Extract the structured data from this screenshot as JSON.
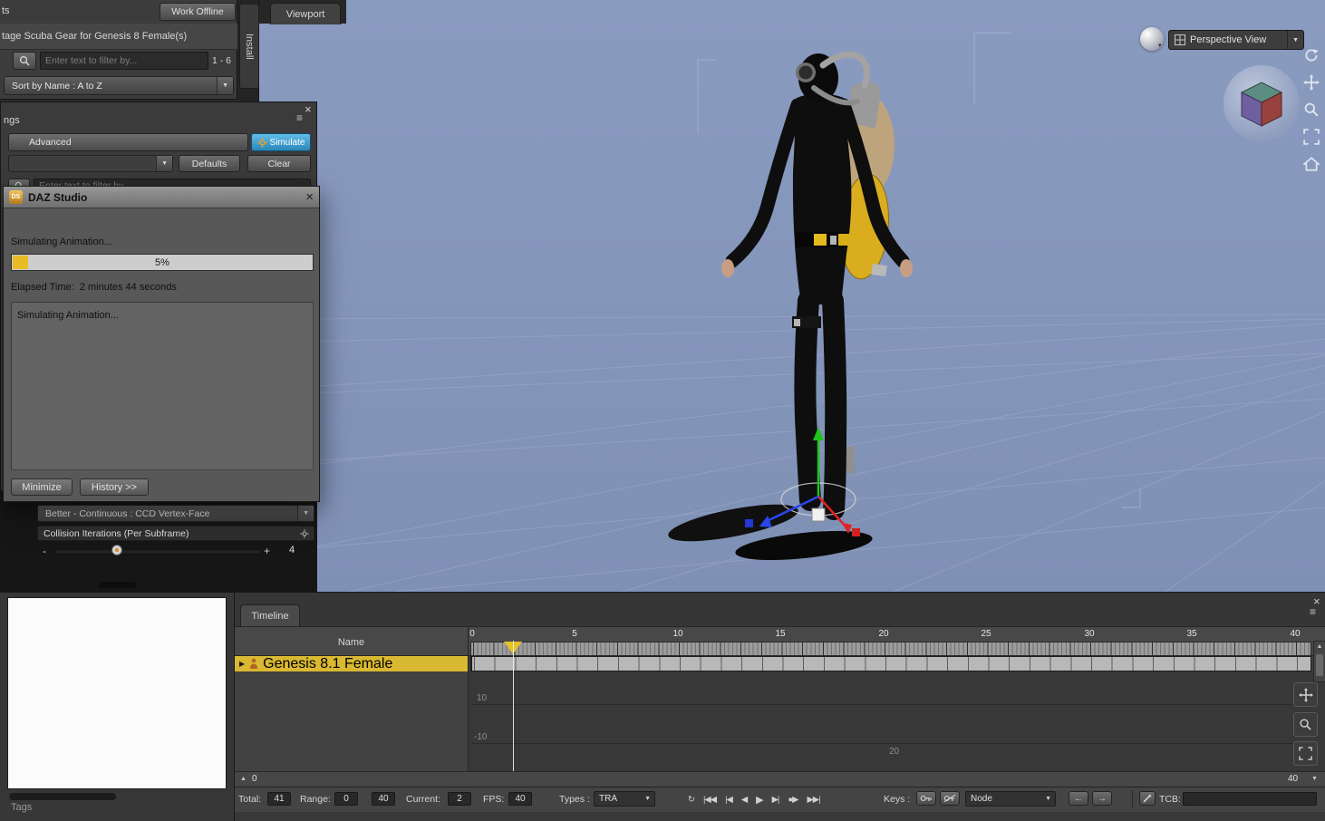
{
  "colors": {
    "viewport_blue": "#8495bb",
    "accent_yellow": "#e3bd2c",
    "simulate_blue": "#3d9fd6",
    "track_yellow": "#d8b832",
    "panel_dark": "#3c3c3c"
  },
  "content_panel": {
    "left_truncated": "ts",
    "work_offline": "Work Offline",
    "product_title": "tage Scuba Gear for Genesis 8 Female(s)",
    "filter_placeholder": "Enter text to filter by...",
    "result_count": "1 - 6",
    "sort_label": "Sort by Name : A to Z"
  },
  "install_tab": {
    "label": "Install"
  },
  "viewport": {
    "tab_label": "Viewport",
    "view_selector": "Perspective View"
  },
  "sim_panel": {
    "tab_truncated": "ngs",
    "advanced_tab": "Advanced",
    "simulate_button": "Simulate",
    "defaults_button": "Defaults",
    "clear_button": "Clear",
    "filter_placeholder": "Enter text to filter by...",
    "collision_mode": "Better - Continuous : CCD Vertex-Face",
    "collision_header": "Collision Iterations (Per Subframe)",
    "slider_minus": "-",
    "slider_plus": "+",
    "slider_value": "4"
  },
  "dialog": {
    "logo": "DS",
    "title": "DAZ Studio",
    "status": "Simulating Animation...",
    "progress_percent": 5,
    "progress_label": "5%",
    "elapsed": "Elapsed Time:  2 minutes 44 seconds",
    "log_text": "Simulating Animation...",
    "minimize_button": "Minimize",
    "history_button": "History >>"
  },
  "bottom_left": {
    "tags_label": "Tags"
  },
  "timeline": {
    "tab_label": "Timeline",
    "name_header": "Name",
    "ruler": [
      "0",
      "5",
      "10",
      "15",
      "20",
      "25",
      "30",
      "35",
      "40"
    ],
    "track_name": "Genesis 8.1 Female",
    "graph_label_upper": "10",
    "graph_label_lower": "-10",
    "graph_label_frame": "20",
    "scroll_start": "0",
    "scroll_end": "40",
    "controls": {
      "total_label": "Total:",
      "total_value": "41",
      "range_label": "Range:",
      "range_start": "0",
      "range_end": "40",
      "current_label": "Current:",
      "current_value": "2",
      "fps_label": "FPS:",
      "fps_value": "40",
      "types_label": "Types :",
      "types_value": "TRA",
      "keys_label": "Keys :",
      "node_value": "Node",
      "tcb_label": "TCB:"
    },
    "playback": [
      {
        "name": "loop-button",
        "glyph": "↻"
      },
      {
        "name": "go-to-start-button",
        "glyph": "|◀◀"
      },
      {
        "name": "previous-keyframe-button",
        "glyph": "|◀"
      },
      {
        "name": "step-back-button",
        "glyph": "◀"
      },
      {
        "name": "play-button",
        "glyph": "▶"
      },
      {
        "name": "step-forward-button",
        "glyph": "▶|"
      },
      {
        "name": "record-button",
        "glyph": "●▶"
      },
      {
        "name": "go-to-end-button",
        "glyph": "▶▶|"
      }
    ]
  }
}
